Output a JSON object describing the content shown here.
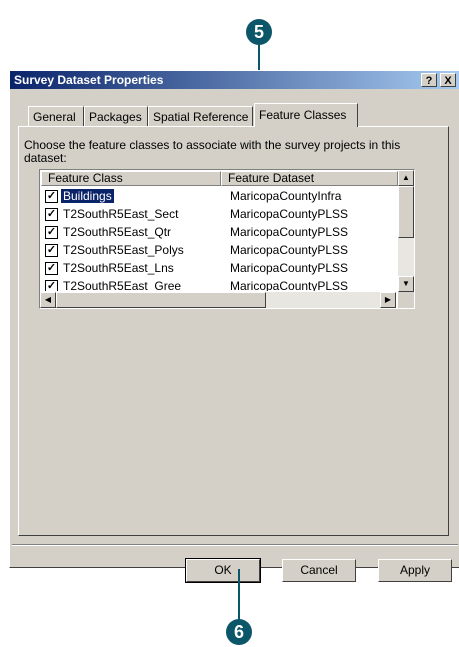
{
  "callouts": {
    "top": "5",
    "bottom": "6"
  },
  "dialog": {
    "title": "Survey Dataset Properties",
    "help_button": "?",
    "close_button": "X"
  },
  "tabs": [
    "General",
    "Packages",
    "Spatial Reference",
    "Feature Classes"
  ],
  "active_tab": "Feature Classes",
  "instruction": "Choose the feature classes to associate with the survey projects in this dataset:",
  "table": {
    "headers": [
      "Feature Class",
      "Feature Dataset"
    ],
    "rows": [
      {
        "feature_class": "Buildings",
        "feature_dataset": "MaricopaCountyInfra",
        "checked": true,
        "selected": true
      },
      {
        "feature_class": "T2SouthR5East_Sect",
        "feature_dataset": "MaricopaCountyPLSS",
        "checked": true,
        "selected": false
      },
      {
        "feature_class": "T2SouthR5East_Qtr",
        "feature_dataset": "MaricopaCountyPLSS",
        "checked": true,
        "selected": false
      },
      {
        "feature_class": "T2SouthR5East_Polys",
        "feature_dataset": "MaricopaCountyPLSS",
        "checked": true,
        "selected": false
      },
      {
        "feature_class": "T2SouthR5East_Lns",
        "feature_dataset": "MaricopaCountyPLSS",
        "checked": true,
        "selected": false
      },
      {
        "feature_class": "T2SouthR5East_Gree",
        "feature_dataset": "MaricopaCountyPLSS",
        "checked": true,
        "selected": false
      }
    ]
  },
  "buttons": {
    "ok": "OK",
    "cancel": "Cancel",
    "apply": "Apply"
  }
}
